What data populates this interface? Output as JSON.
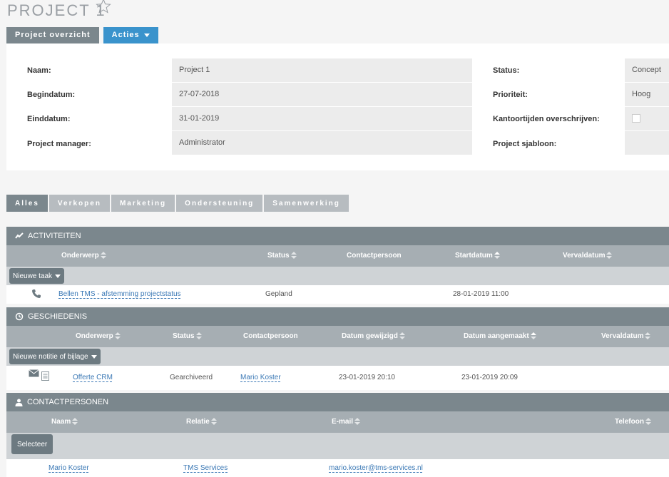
{
  "header": {
    "title": "PROJECT 1"
  },
  "top_tabs": {
    "overview_label": "Project overzicht",
    "actions_label": "Acties"
  },
  "details": {
    "left": [
      {
        "label": "Naam:",
        "value": "Project 1"
      },
      {
        "label": "Begindatum:",
        "value": "27-07-2018"
      },
      {
        "label": "Einddatum:",
        "value": "31-01-2019"
      },
      {
        "label": "Project manager:",
        "value": "Administrator"
      }
    ],
    "right": [
      {
        "label": "Status:",
        "value": "Concept"
      },
      {
        "label": "Prioriteit:",
        "value": "Hoog"
      },
      {
        "label": "Kantoortijden overschrijven:",
        "value": ""
      },
      {
        "label": "Project sjabloon:",
        "value": ""
      }
    ]
  },
  "sub_tabs": [
    "Alles",
    "Verkopen",
    "Marketing",
    "Ondersteuning",
    "Samenwerking"
  ],
  "activities": {
    "title": "ACTIVITEITEN",
    "columns": [
      "Onderwerp",
      "Status",
      "Contactpersoon",
      "Startdatum",
      "Vervaldatum"
    ],
    "action_label": "Nieuwe taak",
    "rows": [
      {
        "subject": "Bellen TMS - afstemming projectstatus",
        "status": "Gepland",
        "contact": "",
        "start": "28-01-2019 11:00",
        "due": ""
      }
    ]
  },
  "history": {
    "title": "GESCHIEDENIS",
    "columns": [
      "Onderwerp",
      "Status",
      "Contactpersoon",
      "Datum gewijzigd",
      "Datum aangemaakt",
      "Vervaldatum"
    ],
    "action_label": "Nieuwe notitie of bijlage",
    "rows": [
      {
        "subject": "Offerte CRM",
        "status": "Gearchiveerd",
        "contact": "Mario Koster",
        "modified": "23-01-2019 20:10",
        "created": "23-01-2019 20:09",
        "due": ""
      }
    ]
  },
  "contacts": {
    "title": "CONTACTPERSONEN",
    "columns": [
      "Naam",
      "Relatie",
      "E-mail",
      "Telefoon"
    ],
    "action_label": "Selecteer",
    "rows": [
      {
        "name": "Mario Koster",
        "relation": "TMS Services",
        "email": "mario.koster@tms-services.nl",
        "phone": ""
      }
    ]
  },
  "colors": {
    "accent": "#3a93cc",
    "header_grey": "#7b878d",
    "link": "#3a78b5"
  }
}
